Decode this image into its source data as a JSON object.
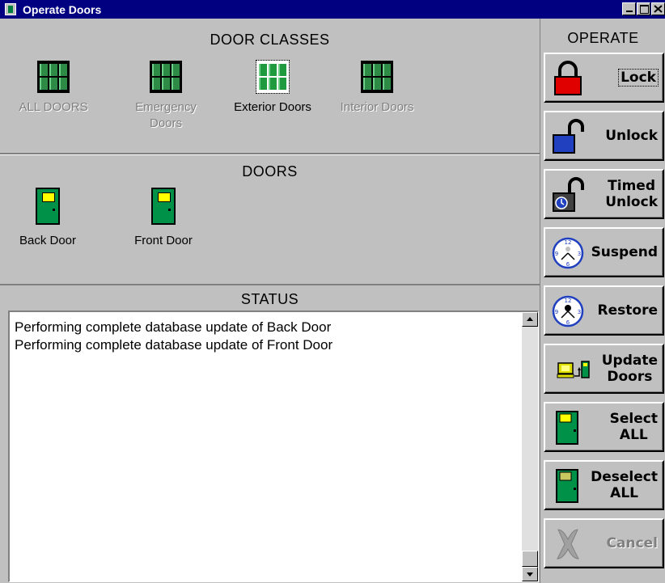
{
  "window": {
    "title": "Operate Doors"
  },
  "door_classes": {
    "header": "DOOR CLASSES",
    "items": [
      {
        "line1": "ALL DOORS",
        "line2": "",
        "enabled": false
      },
      {
        "line1": "Emergency",
        "line2": "Doors",
        "enabled": false
      },
      {
        "line1": "Exterior Doors",
        "line2": "",
        "enabled": true,
        "selected": true
      },
      {
        "line1": "Interior Doors",
        "line2": "",
        "enabled": false
      }
    ]
  },
  "doors": {
    "header": "DOORS",
    "items": [
      {
        "label": "Back Door"
      },
      {
        "label": "Front Door"
      }
    ]
  },
  "status": {
    "header": "STATUS",
    "lines": [
      "Performing complete database update of Back Door",
      "Performing complete database update of Front Door"
    ]
  },
  "operate": {
    "header": "OPERATE",
    "buttons": [
      {
        "line1": "Lock",
        "line2": "",
        "icon": "padlock-locked-icon",
        "enabled": true,
        "focused": true
      },
      {
        "line1": "Unlock",
        "line2": "",
        "icon": "padlock-unlocked-icon",
        "enabled": true
      },
      {
        "line1": "Timed",
        "line2": "Unlock",
        "icon": "timed-unlock-icon",
        "enabled": true
      },
      {
        "line1": "Suspend",
        "line2": "",
        "icon": "clock-icon",
        "enabled": true
      },
      {
        "line1": "Restore",
        "line2": "",
        "icon": "clock-restore-icon",
        "enabled": true
      },
      {
        "line1": "Update",
        "line2": "Doors",
        "icon": "computer-to-door-icon",
        "enabled": true
      },
      {
        "line1": "Select",
        "line2": "ALL",
        "icon": "door-select-icon",
        "enabled": true
      },
      {
        "line1": "Deselect",
        "line2": "ALL",
        "icon": "door-deselect-icon",
        "enabled": true
      },
      {
        "line1": "Cancel",
        "line2": "",
        "icon": "cancel-x-icon",
        "enabled": false
      }
    ]
  },
  "colors": {
    "titlebar": "#000080",
    "face": "#c0c0c0",
    "door_green": "#009148",
    "door_window": "#ffff00",
    "lock_red": "#e00000",
    "lock_blue": "#2040c0"
  }
}
